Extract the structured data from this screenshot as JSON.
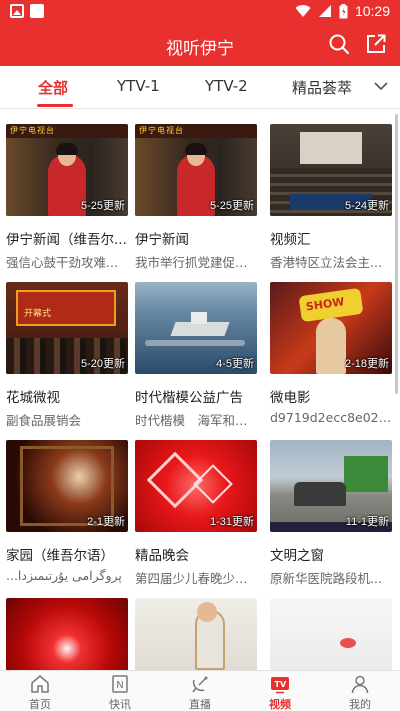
{
  "status_bar": {
    "time": "10:29"
  },
  "app_bar": {
    "title": "视听伊宁"
  },
  "tabs": [
    {
      "label": "全部",
      "active": true
    },
    {
      "label": "YTV-1",
      "active": false
    },
    {
      "label": "YTV-2",
      "active": false
    },
    {
      "label": "精品荟萃",
      "active": false
    }
  ],
  "cards": [
    {
      "title": "伊宁新闻（维吾尔...",
      "subtitle": "强信心鼓干劲攻难...",
      "badge": "5-25更新",
      "thumb": "news-anchor",
      "thumb_text": "伊宁电视台"
    },
    {
      "title": "伊宁新闻",
      "subtitle": "我市举行抓党建促脱...",
      "badge": "5-25更新",
      "thumb": "news-anchor",
      "thumb_text": "伊宁电视台"
    },
    {
      "title": "视频汇",
      "subtitle": "香港特区立法会主...",
      "badge": "5-24更新",
      "thumb": "hall"
    },
    {
      "title": "花城微视",
      "subtitle": "副食品展销会",
      "badge": "5-20更新",
      "thumb": "expo",
      "thumb_text": "开幕式"
    },
    {
      "title": "时代楷模公益广告",
      "subtitle": "时代楷模　海军和平...",
      "badge": "4-5更新",
      "thumb": "ship"
    },
    {
      "title": "微电影",
      "subtitle": "d9719d2ecc8e027f...",
      "badge": "2-18更新",
      "thumb": "film",
      "thumb_text": "SHOW"
    },
    {
      "title": "家园（维吾尔语）",
      "subtitle": "...پروگرامى  يۇرتىمىزدا",
      "badge": "2-1更新",
      "thumb": "home"
    },
    {
      "title": "精品晚会",
      "subtitle": "第四届少儿春晚少儿...",
      "badge": "1-31更新",
      "thumb": "gala"
    },
    {
      "title": "文明之窗",
      "subtitle": "原新华医院路段机...",
      "badge": "11-1更新",
      "thumb": "street"
    },
    {
      "title": "",
      "subtitle": "",
      "badge": "",
      "thumb": "red"
    },
    {
      "title": "",
      "subtitle": "",
      "badge": "",
      "thumb": "kid"
    },
    {
      "title": "",
      "subtitle": "",
      "badge": "",
      "thumb": "white"
    }
  ],
  "bottom_nav": [
    {
      "label": "首页",
      "icon": "home-icon",
      "active": false
    },
    {
      "label": "快讯",
      "icon": "news-icon",
      "active": false
    },
    {
      "label": "直播",
      "icon": "live-icon",
      "active": false
    },
    {
      "label": "视频",
      "icon": "tv-icon",
      "active": true
    },
    {
      "label": "我的",
      "icon": "user-icon",
      "active": false
    }
  ],
  "colors": {
    "accent": "#e8312f"
  }
}
